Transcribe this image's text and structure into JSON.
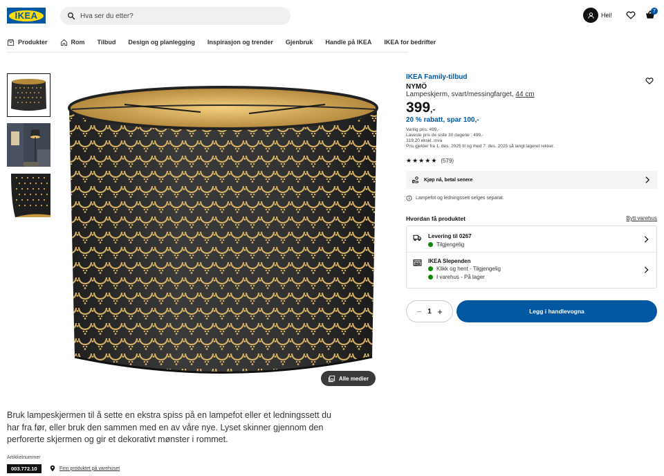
{
  "header": {
    "logo_text": "IKEA",
    "search_placeholder": "Hva ser du etter?",
    "greeting": "Hei!",
    "cart_count": "7"
  },
  "nav": {
    "items": [
      {
        "label": "Produkter",
        "icon": "box-icon"
      },
      {
        "label": "Rom",
        "icon": "house-icon"
      },
      {
        "label": "Tilbud"
      },
      {
        "label": "Design og planlegging"
      },
      {
        "label": "Inspirasjon og trender"
      },
      {
        "label": "Gjenbruk"
      },
      {
        "label": "Handle på IKEA"
      },
      {
        "label": "IKEA for bedrifter"
      }
    ]
  },
  "gallery": {
    "media_button": "Alle medier"
  },
  "product": {
    "offer_label": "IKEA Family-tilbud",
    "name": "NYMÖ",
    "description": "Lampeskjerm, svart/messingfarget,",
    "size": "44 cm",
    "price": "399",
    "price_suffix": ",-",
    "discount": "20 % rabatt, spar 100,-",
    "fine_print": [
      "Vanlig pris: 499,-",
      "Laveste pris de siste 30 dagene : 499,-",
      "319,20 ekskl. mva",
      "Pris gjelder fra 1. des. 2025 til og med 7. des. 2025 så langt lageret rekker."
    ],
    "rating_stars": 4.5,
    "rating_count": "(579)"
  },
  "klarna": {
    "label": "Kjøp nå, betal senere"
  },
  "note": "Lampefot og ledningssett selges separat.",
  "delivery": {
    "title": "Hvordan få produktet",
    "change_store": "Bytt varehus",
    "rows": [
      {
        "title": "Levering til 0267",
        "status": [
          "Tilgjengelig"
        ]
      },
      {
        "title": "IKEA Slependen",
        "status": [
          "Klikk og hent - Tilgjengelig",
          "I varehus - På lager"
        ]
      }
    ]
  },
  "purchase": {
    "quantity": "1",
    "add_to_cart": "Legg i handlevogna"
  },
  "details": {
    "description": "Bruk lampeskjermen til å sette en ekstra spiss på en lampefot eller et ledningssett du har fra før, eller bruk den sammen med en av våre nye. Lyset skinner gjennom den perforerte skjermen og gir et dekorativt mønster i rommet.",
    "article_label": "Artikkelnummer",
    "article_number": "003.772.10",
    "find_in_store": "Finn produktet på varehuset"
  },
  "colors": {
    "brand_blue": "#0058a3",
    "brand_yellow": "#ffdb00",
    "available_green": "#0a8a00"
  }
}
